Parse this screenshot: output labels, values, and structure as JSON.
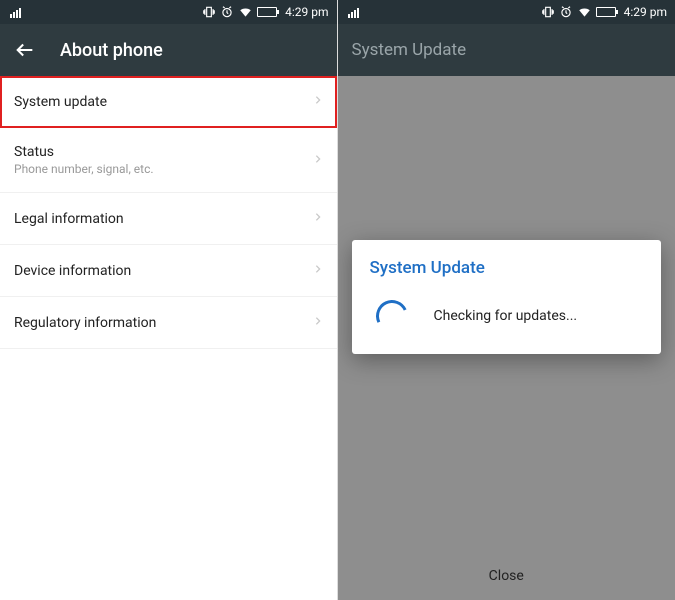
{
  "statusbar": {
    "time": "4:29 pm"
  },
  "left": {
    "appbar_title": "About phone",
    "rows": [
      {
        "primary": "System update"
      },
      {
        "primary": "Status",
        "secondary": "Phone number, signal, etc."
      },
      {
        "primary": "Legal information"
      },
      {
        "primary": "Device information"
      },
      {
        "primary": "Regulatory information"
      }
    ]
  },
  "right": {
    "appbar_title": "System Update",
    "dialog_title": "System Update",
    "dialog_message": "Checking for updates...",
    "close_label": "Close"
  }
}
